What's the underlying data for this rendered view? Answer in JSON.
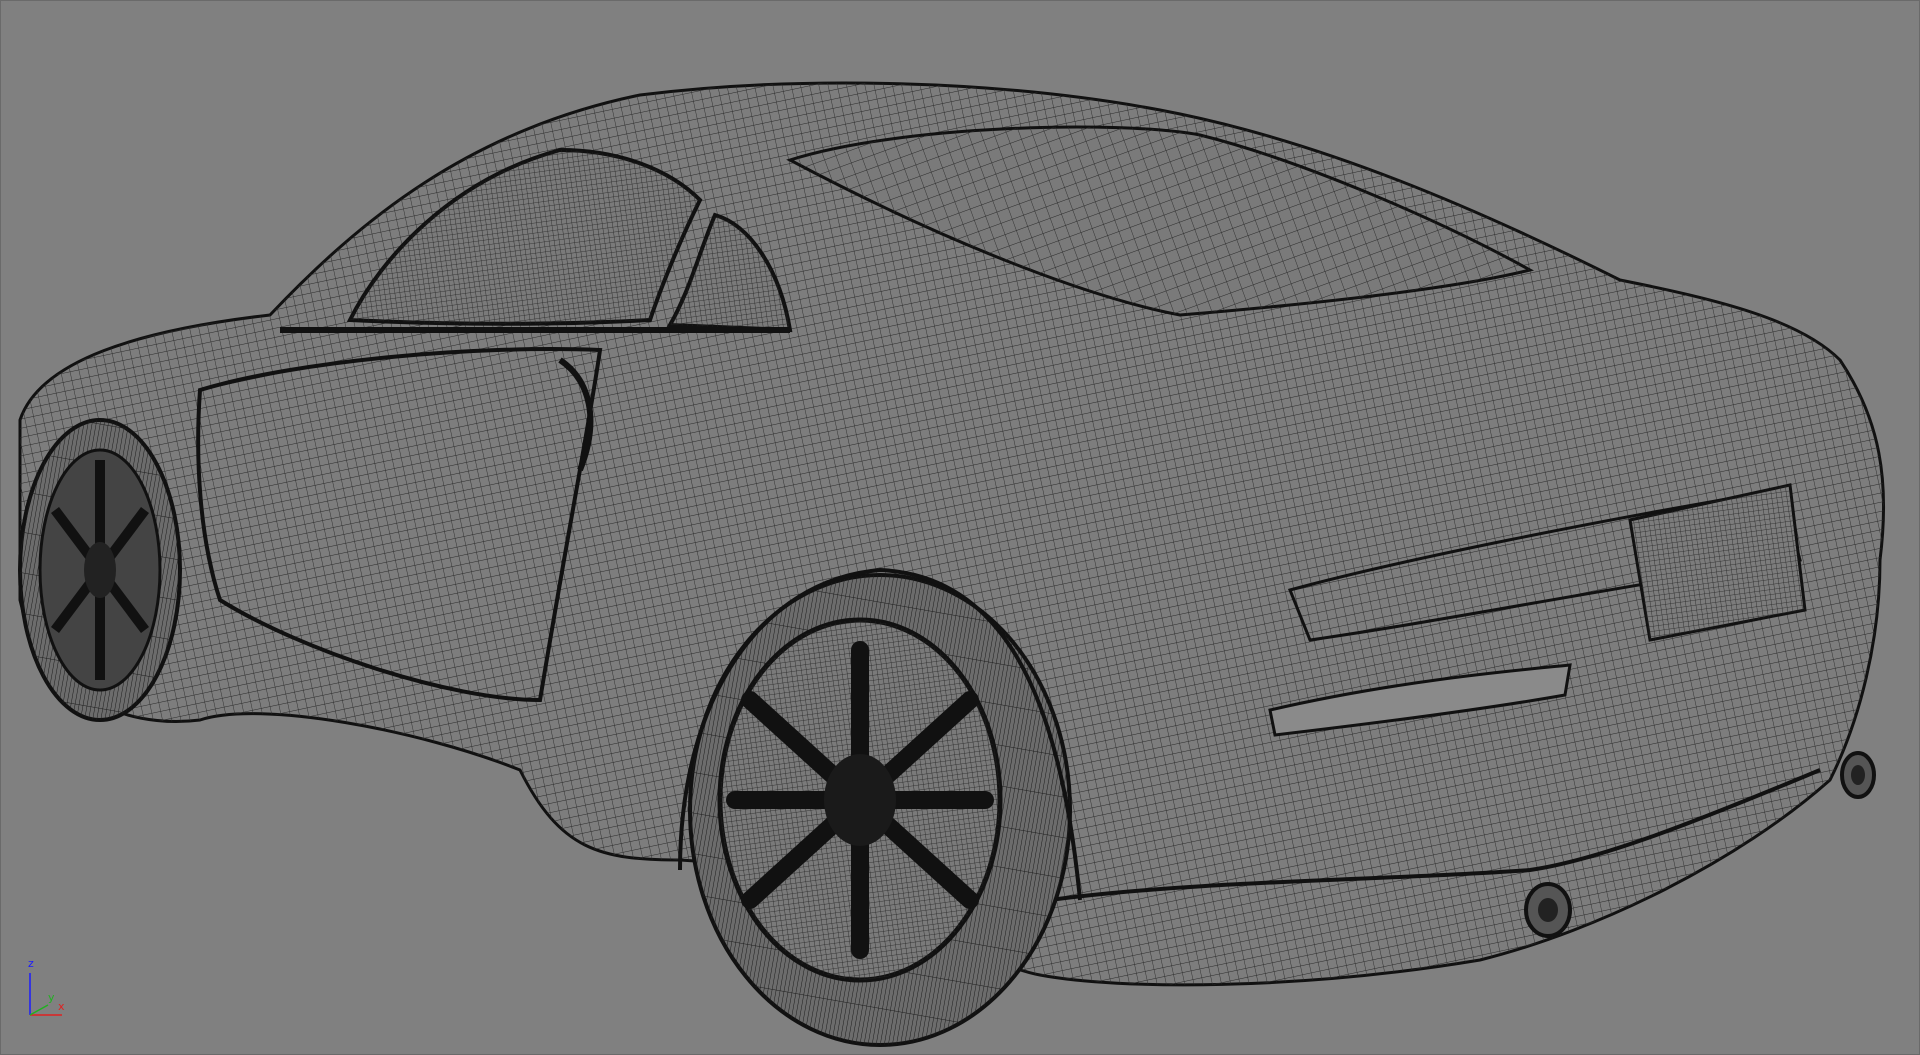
{
  "viewport": {
    "background_color": "#808080",
    "wire_color": "#1a1a1a",
    "content": "car-wireframe-mesh"
  },
  "axis_gizmo": {
    "z_label": "z",
    "x_label": "x",
    "y_label": "y",
    "z_color": "#1a1aff",
    "x_color": "#e02020",
    "y_color": "#20b020"
  }
}
